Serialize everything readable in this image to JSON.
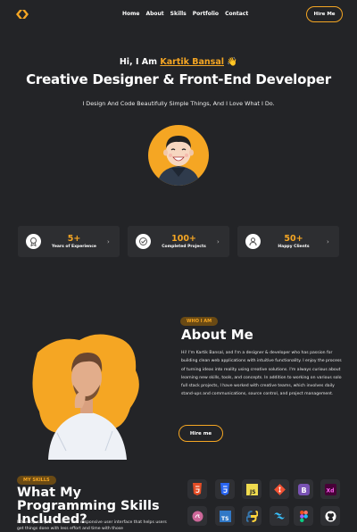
{
  "nav": {
    "links": [
      "Home",
      "About",
      "Skills",
      "Portfolio",
      "Contact"
    ],
    "hire_label": "Hire Me"
  },
  "hero": {
    "greeting": "Hi, I Am",
    "name": "Kartik Bansal",
    "wave": "👋",
    "headline": "Creative Designer & Front-End Developer",
    "tagline": "I Design And Code Beautifully Simple Things, And I Love What I Do."
  },
  "stats": [
    {
      "value": "5+",
      "label": "Years of Experience",
      "icon": "medal-icon"
    },
    {
      "value": "100+",
      "label": "Completed Projects",
      "icon": "check-badge-icon"
    },
    {
      "value": "50+",
      "label": "Happy Clients",
      "icon": "client-icon"
    }
  ],
  "about": {
    "badge": "WHO I AM",
    "title": "About Me",
    "text": "Hi! I'm Kartik Bansal, and I'm a designer & developer who has passion for building clean web applications with intuitive functionality. I enjoy the process of turning ideas into reality using creative solutions. I'm always curious about learning new skills, tools, and concepts. In addition to working on various solo full stack projects, I have worked with creative teams, which involves daily stand-ups and communications, source control, and project management.",
    "button": "Hire me"
  },
  "skills": {
    "badge": "MY SKILLS",
    "title": "What My Programming Skills Included?",
    "text": "I develop simple, intuitive and responsive user interface that helps users get things done with less effort and time with those",
    "icons": [
      "html5-icon",
      "css3-icon",
      "javascript-icon",
      "git-icon",
      "bootstrap-icon",
      "adobe-xd-icon",
      "sass-icon",
      "typescript-icon",
      "python-icon",
      "tailwind-icon",
      "figma-icon",
      "github-icon"
    ]
  },
  "colors": {
    "accent": "#f5a623",
    "background": "#232427",
    "card": "#2d2e31"
  }
}
